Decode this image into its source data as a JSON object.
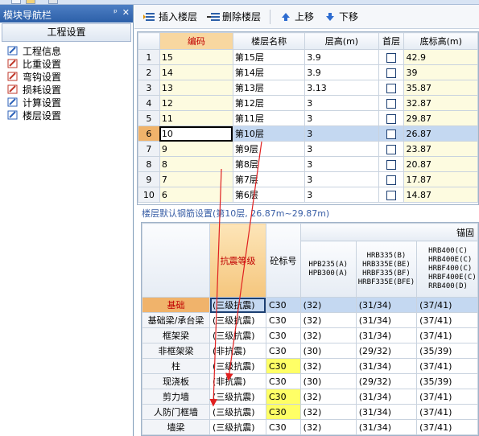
{
  "nav": {
    "title": "模块导航栏",
    "pin_icon": "pin-icon",
    "close_glyph": "✕",
    "pin_glyph": "ᵖ",
    "header": "工程设置",
    "items": [
      {
        "label": "工程信息",
        "icon": "info-icon",
        "color": "#2d62b8"
      },
      {
        "label": "比重设置",
        "icon": "weight-icon",
        "color": "#c0392b"
      },
      {
        "label": "弯钩设置",
        "icon": "hook-icon",
        "color": "#c0392b"
      },
      {
        "label": "损耗设置",
        "icon": "loss-icon",
        "color": "#c0392b"
      },
      {
        "label": "计算设置",
        "icon": "calc-icon",
        "color": "#2d62b8"
      },
      {
        "label": "楼层设置",
        "icon": "floors-icon",
        "color": "#2d62b8"
      }
    ]
  },
  "toolbar": {
    "insert_label": "插入楼层",
    "delete_label": "删除楼层",
    "up_label": "上移",
    "down_label": "下移"
  },
  "floor_table": {
    "headers": [
      "编码",
      "楼层名称",
      "层高(m)",
      "首层",
      "底标高(m)"
    ],
    "selected_row": 6,
    "rows": [
      {
        "n": "1",
        "code": "15",
        "name": "第15层",
        "h": "3.9",
        "base": "42.9"
      },
      {
        "n": "2",
        "code": "14",
        "name": "第14层",
        "h": "3.9",
        "base": "39"
      },
      {
        "n": "3",
        "code": "13",
        "name": "第13层",
        "h": "3.13",
        "base": "35.87"
      },
      {
        "n": "4",
        "code": "12",
        "name": "第12层",
        "h": "3",
        "base": "32.87"
      },
      {
        "n": "5",
        "code": "11",
        "name": "第11层",
        "h": "3",
        "base": "29.87"
      },
      {
        "n": "6",
        "code": "10",
        "name": "第10层",
        "h": "3",
        "base": "26.87"
      },
      {
        "n": "7",
        "code": "9",
        "name": "第9层",
        "h": "3",
        "base": "23.87"
      },
      {
        "n": "8",
        "code": "8",
        "name": "第8层",
        "h": "3",
        "base": "20.87"
      },
      {
        "n": "9",
        "code": "7",
        "name": "第7层",
        "h": "3",
        "base": "17.87"
      },
      {
        "n": "10",
        "code": "6",
        "name": "第6层",
        "h": "3",
        "base": "14.87"
      }
    ]
  },
  "rebar_section_title": "楼层默认钢筋设置(第10层, 26.87m~29.87m)",
  "rebar_table": {
    "col_seismic": "抗震等级",
    "col_concrete": "砼标号",
    "group_header": "锚固",
    "sub_headers": [
      [
        "HPB235(A)",
        "HPB300(A)"
      ],
      [
        "HRB335(B)",
        "HRB335E(BE)",
        "HRBF335(BF)",
        "HRBF335E(BFE)"
      ],
      [
        "HRB400(C)",
        "HRB400E(C)",
        "HRBF400(C)",
        "HRBF400E(C)",
        "RRB400(D)"
      ]
    ],
    "rows": [
      {
        "comp": "基础",
        "level": "(三级抗震)",
        "concrete": "C30",
        "v1": "(32)",
        "v2": "(31/34)",
        "v3": "(37/41)",
        "yellow": false
      },
      {
        "comp": "基础梁/承台梁",
        "level": "(三级抗震)",
        "concrete": "C30",
        "v1": "(32)",
        "v2": "(31/34)",
        "v3": "(37/41)",
        "yellow": false
      },
      {
        "comp": "框架梁",
        "level": "(三级抗震)",
        "concrete": "C30",
        "v1": "(32)",
        "v2": "(31/34)",
        "v3": "(37/41)",
        "yellow": false
      },
      {
        "comp": "非框架梁",
        "level": "(非抗震)",
        "concrete": "C30",
        "v1": "(30)",
        "v2": "(29/32)",
        "v3": "(35/39)",
        "yellow": false
      },
      {
        "comp": "柱",
        "level": "(三级抗震)",
        "concrete": "C30",
        "v1": "(32)",
        "v2": "(31/34)",
        "v3": "(37/41)",
        "yellow": true
      },
      {
        "comp": "现浇板",
        "level": "(非抗震)",
        "concrete": "C30",
        "v1": "(30)",
        "v2": "(29/32)",
        "v3": "(35/39)",
        "yellow": false
      },
      {
        "comp": "剪力墙",
        "level": "(三级抗震)",
        "concrete": "C30",
        "v1": "(32)",
        "v2": "(31/34)",
        "v3": "(37/41)",
        "yellow": true
      },
      {
        "comp": "人防门框墙",
        "level": "(三级抗震)",
        "concrete": "C30",
        "v1": "(32)",
        "v2": "(31/34)",
        "v3": "(37/41)",
        "yellow": true
      },
      {
        "comp": "墙梁",
        "level": "(三级抗震)",
        "concrete": "C30",
        "v1": "(32)",
        "v2": "(31/34)",
        "v3": "(37/41)",
        "yellow": false
      }
    ]
  },
  "colors": {
    "accent": "#2c5fa8",
    "selection": "#c4d8f1",
    "row_highlight": "#f0b36b",
    "arrow": "#e02020"
  }
}
